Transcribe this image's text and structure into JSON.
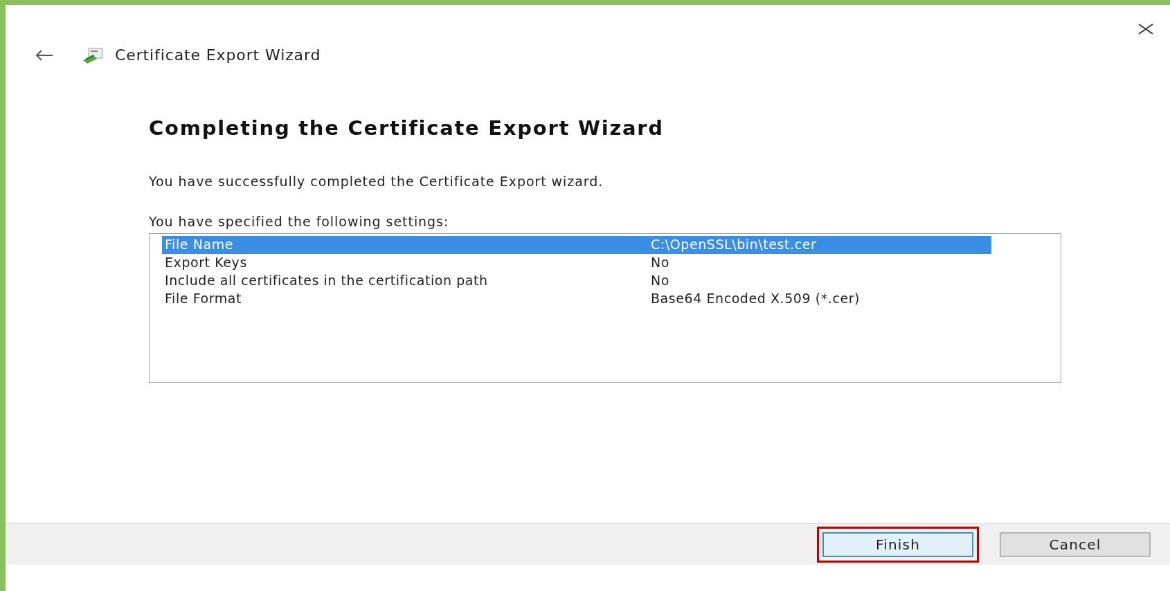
{
  "window": {
    "title": "Certificate Export Wizard"
  },
  "heading": "Completing the Certificate Export Wizard",
  "message": "You have successfully completed the Certificate Export wizard.",
  "settings_label": "You have specified the following settings:",
  "settings": [
    {
      "label": "File Name",
      "value": "C:\\OpenSSL\\bin\\test.cer",
      "selected": true
    },
    {
      "label": "Export Keys",
      "value": "No",
      "selected": false
    },
    {
      "label": "Include all certificates in the certification path",
      "value": "No",
      "selected": false
    },
    {
      "label": "File Format",
      "value": "Base64 Encoded X.509 (*.cer)",
      "selected": false
    }
  ],
  "buttons": [
    {
      "label": "Finish",
      "kind": "default",
      "highlighted": true
    },
    {
      "label": "Cancel",
      "kind": "normal",
      "highlighted": false
    }
  ]
}
